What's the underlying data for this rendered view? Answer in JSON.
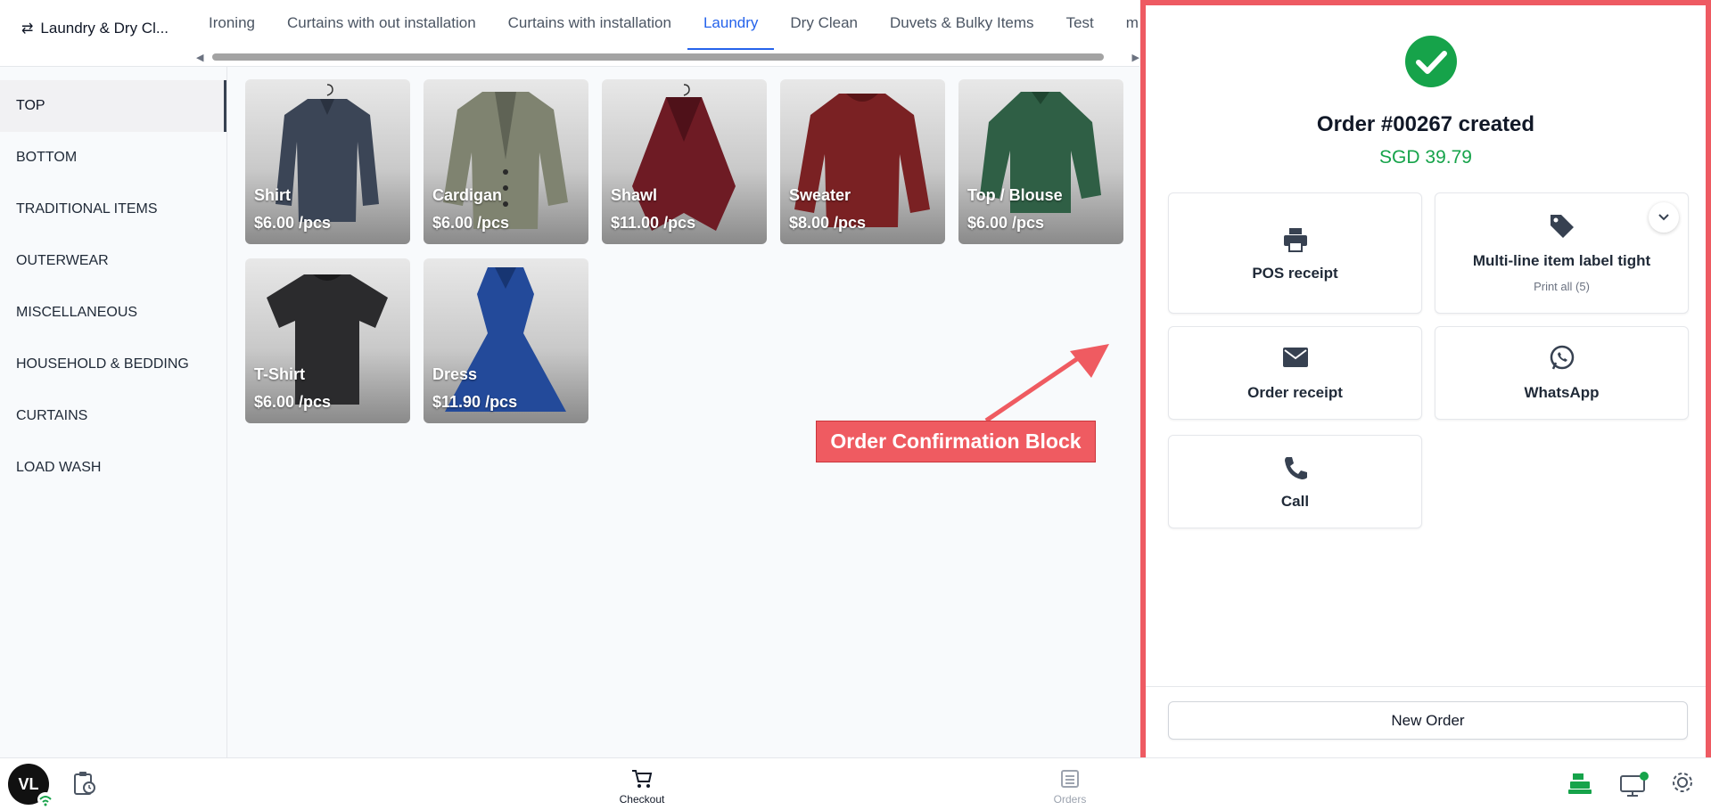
{
  "header": {
    "store_name": "Laundry & Dry Cl...",
    "tabs": [
      {
        "label": "Ironing"
      },
      {
        "label": "Curtains with out installation"
      },
      {
        "label": "Curtains with installation"
      },
      {
        "label": "Laundry"
      },
      {
        "label": "Dry Clean"
      },
      {
        "label": "Duvets & Bulky Items"
      },
      {
        "label": "Test"
      },
      {
        "label": "m"
      }
    ],
    "active_tab": "Laundry"
  },
  "sidebar": {
    "categories": [
      {
        "label": "TOP"
      },
      {
        "label": "BOTTOM"
      },
      {
        "label": "TRADITIONAL ITEMS"
      },
      {
        "label": "OUTERWEAR"
      },
      {
        "label": "MISCELLANEOUS"
      },
      {
        "label": "HOUSEHOLD & BEDDING"
      },
      {
        "label": "CURTAINS"
      },
      {
        "label": "LOAD WASH"
      }
    ],
    "active": "TOP"
  },
  "products": [
    {
      "name": "Shirt",
      "price": "$6.00 /pcs",
      "color": "#3b4556"
    },
    {
      "name": "Cardigan",
      "price": "$6.00 /pcs",
      "color": "#7f8370"
    },
    {
      "name": "Shawl",
      "price": "$11.00 /pcs",
      "color": "#6e1b24"
    },
    {
      "name": "Sweater",
      "price": "$8.00 /pcs",
      "color": "#7a2123"
    },
    {
      "name": "Top / Blouse",
      "price": "$6.00 /pcs",
      "color": "#2f5f45"
    },
    {
      "name": "T-Shirt",
      "price": "$6.00 /pcs",
      "color": "#2b2b2d"
    },
    {
      "name": "Dress",
      "price": "$11.90 /pcs",
      "color": "#234a9a"
    }
  ],
  "annotation": {
    "label": "Order Confirmation Block",
    "color": "#ef5b61"
  },
  "order": {
    "title": "Order #00267 created",
    "amount": "SGD 39.79",
    "actions": {
      "pos_receipt": "POS receipt",
      "item_label": "Multi-line item label tight",
      "item_label_sub": "Print all (5)",
      "order_receipt": "Order receipt",
      "whatsapp": "WhatsApp",
      "call": "Call"
    },
    "new_order": "New Order"
  },
  "bottom_bar": {
    "avatar_initials": "VL",
    "checkout": "Checkout",
    "orders": "Orders"
  },
  "colors": {
    "accent": "#2563eb",
    "success": "#16a34a",
    "highlight": "#ee5a62"
  }
}
